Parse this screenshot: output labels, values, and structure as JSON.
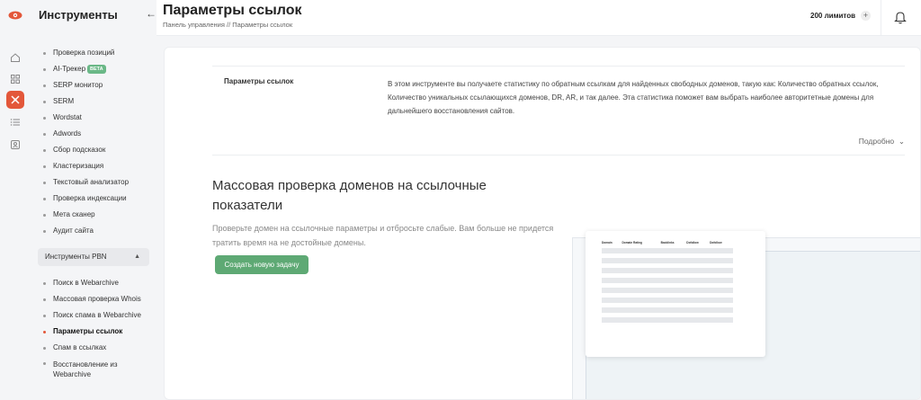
{
  "sidebar": {
    "title": "Инструменты",
    "items": [
      {
        "label": "Проверка позиций"
      },
      {
        "label": "AI-Трекер",
        "badge": "BETA"
      },
      {
        "label": "SERP монитор"
      },
      {
        "label": "SERM"
      },
      {
        "label": "Wordstat"
      },
      {
        "label": "Adwords"
      },
      {
        "label": "Сбор подсказок"
      },
      {
        "label": "Кластеризация"
      },
      {
        "label": "Текстовый анализатор"
      },
      {
        "label": "Проверка индексации"
      },
      {
        "label": "Мета сканер"
      },
      {
        "label": "Аудит сайта"
      }
    ],
    "pbn_group": "Инструменты PBN",
    "pbn_items": [
      {
        "label": "Поиск в Webarchive"
      },
      {
        "label": "Массовая проверка Whois"
      },
      {
        "label": "Поиск спама в Webarchive"
      },
      {
        "label": "Параметры ссылок",
        "active": true
      },
      {
        "label": "Спам в ссылках"
      },
      {
        "label": "Восстановление из Webarchive"
      }
    ]
  },
  "header": {
    "title": "Параметры ссылок",
    "breadcrumb": "Панель управления  //  Параметры ссылок",
    "limits": "200 лимитов",
    "limits_plus": "+"
  },
  "info": {
    "label": "Параметры ссылок",
    "text": "В этом инструменте вы получаете статистику по обратным ссылкам для найденных свободных доменов, такую как: Количество обратных ссылок, Количество уникальных ссылающихся доменов, DR, AR, и так далее. Эта статистика поможет вам выбрать наиболее авторитетные домены для дальнейшего восстановления сайтов.",
    "more": "Подробно"
  },
  "hero": {
    "title": "Массовая проверка доменов на ссылочные показатели",
    "description": "Проверьте домен на ссылочные параметры и отбросьте слабые. Вам больше не придется тратить время на не достойные домены.",
    "button": "Создать новую задачу"
  },
  "preview_table": {
    "headers": [
      "Domain",
      "Domain Rating",
      "Backlinks",
      "Dofollow",
      "Dofollow"
    ]
  },
  "colors": {
    "accent": "#e3573a",
    "button_green": "#5ea974",
    "badge_green": "#6ab887"
  }
}
